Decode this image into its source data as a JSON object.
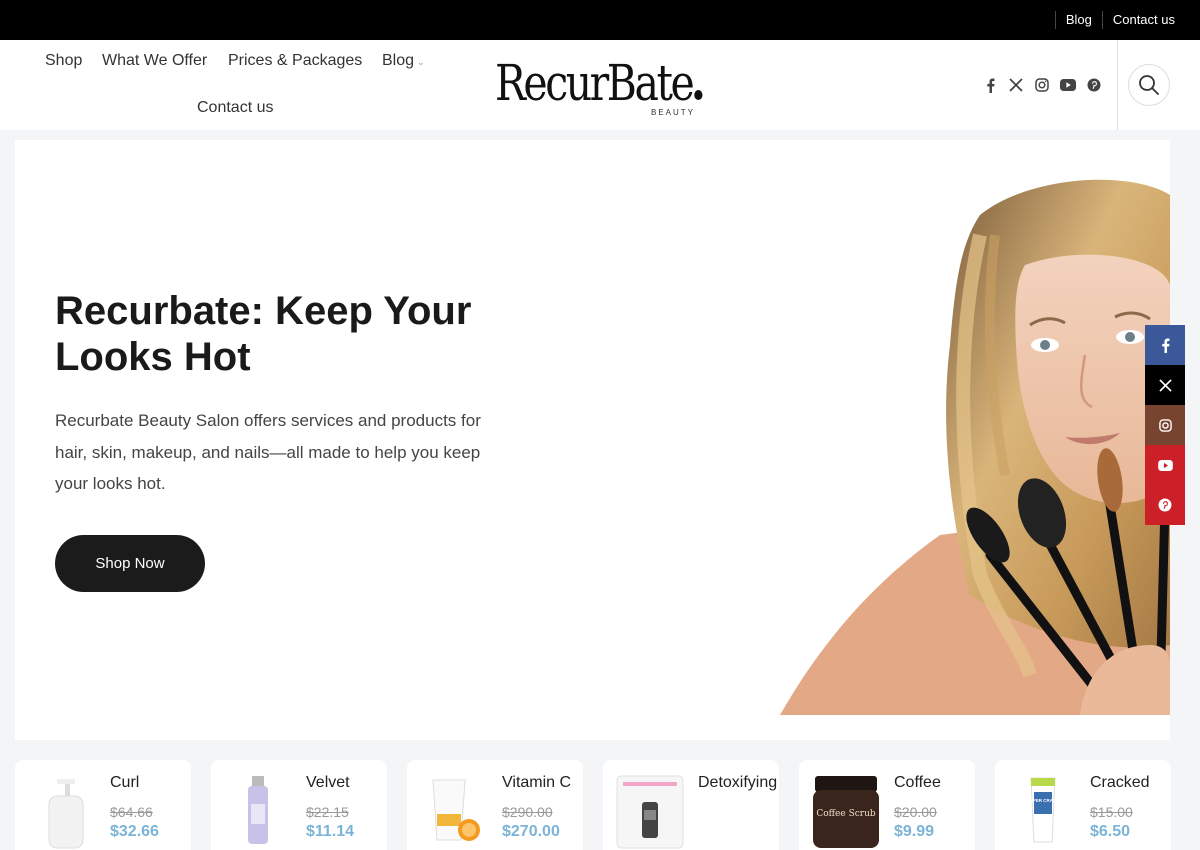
{
  "topbar": {
    "links": [
      "Blog",
      "Contact us"
    ]
  },
  "nav": {
    "items": [
      "Shop",
      "What We Offer",
      "Prices & Packages",
      "Blog",
      "Contact us"
    ],
    "blog_chevron": "⌄"
  },
  "logo": {
    "word": "RecurBate",
    "sub": "BEAUTY"
  },
  "header_social": [
    "facebook-icon",
    "x-icon",
    "instagram-icon",
    "youtube-icon",
    "pinterest-icon"
  ],
  "hero": {
    "title": "Recurbate: Keep Your Looks Hot",
    "text": "Recurbate Beauty Salon offers services and products for hair, skin, makeup, and nails—all made to help you keep your looks hot.",
    "button": "Shop Now"
  },
  "side_social": {
    "colors": {
      "facebook": "#3b5998",
      "x": "#000000",
      "instagram": "#774430",
      "youtube": "#cb2027",
      "pinterest": "#cb2027"
    }
  },
  "products": [
    {
      "name": "Curl",
      "old": "$64.66",
      "new": "$32.66"
    },
    {
      "name": "Velvet",
      "old": "$22.15",
      "new": "$11.14"
    },
    {
      "name": "Vitamin C",
      "old": "$290.00",
      "new": "$270.00"
    },
    {
      "name": "Detoxifying",
      "old": "",
      "new": ""
    },
    {
      "name": "Coffee",
      "old": "$20.00",
      "new": "$9.99"
    },
    {
      "name": "Cracked",
      "old": "$15.00",
      "new": "$6.50"
    }
  ],
  "product_labels": {
    "coffee_jar": "Coffee Scrub",
    "cracked_tube": "SUPER CRACK"
  },
  "accent": "#7bb4d6"
}
